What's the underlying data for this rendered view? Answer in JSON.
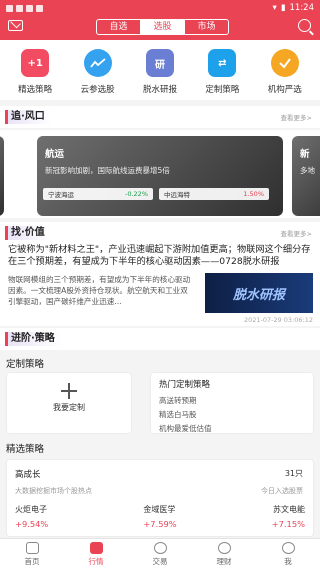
{
  "status": {
    "time": "11:24"
  },
  "nav": {
    "tabs": [
      "自选",
      "选股",
      "市场"
    ],
    "active_index": 1
  },
  "features": [
    {
      "label": "精选策略",
      "icon": "plus-one-ribbon-icon",
      "glyph": "+1"
    },
    {
      "label": "云参选股",
      "icon": "trend-cloud-icon",
      "glyph": ""
    },
    {
      "label": "脱水研报",
      "icon": "report-icon",
      "glyph": "研"
    },
    {
      "label": "定制策略",
      "icon": "custom-arrow-icon",
      "glyph": "⇄"
    },
    {
      "label": "机构严选",
      "icon": "institution-pick-icon",
      "glyph": ""
    }
  ],
  "sections": {
    "wind": {
      "title": "追·风口",
      "more": "查看更多>"
    },
    "value": {
      "title": "找·价值",
      "more": "查看更多>"
    },
    "advance": {
      "title": "进阶·策略"
    }
  },
  "carousel": {
    "main": {
      "title": "航运",
      "desc": "新冠影响加剧，国际航线运费暴增5倍",
      "stocks": [
        {
          "name": "宁波海运",
          "pct": "-0.22%"
        },
        {
          "name": "中远海特",
          "pct": "1.50%"
        }
      ]
    },
    "right": {
      "title": "新",
      "desc": "多地"
    }
  },
  "article": {
    "headline": "它被称为\"新材料之王\"，产业迅速崛起下游附加值更高；物联网这个细分存在三个预期差，有望成为下半年的核心驱动因素——0728脱水研报",
    "body": "物联网模组的三个预期差，有望成为下半年的核心驱动因素。一文梳理A股外资持仓现状。航空航天和工业双引擎驱动，国产碳纤维产业迅速...",
    "thumb_text": "脱水研报",
    "time": "2021-07-29 03:06:12"
  },
  "strategy": {
    "heading": "定制策略",
    "custom_label": "我要定制",
    "hot_title": "热门定制策略",
    "hot_items": [
      "高送转预期",
      "精选白马股",
      "机构最爱低估值"
    ]
  },
  "jingxuan": {
    "heading": "精选策略",
    "name": "高成长",
    "count": "31只",
    "desc": "大数据挖掘市场个股热点",
    "tag": "今日入选股票",
    "stocks": [
      {
        "name": "火炬电子",
        "pct": "+9.54%"
      },
      {
        "name": "金域医学",
        "pct": "+7.59%"
      },
      {
        "name": "苏文电能",
        "pct": "+7.15%"
      }
    ]
  },
  "tabbar": [
    "首页",
    "行情",
    "交易",
    "理财",
    "我"
  ],
  "tabbar_active_index": 1,
  "colors": {
    "brand": "#ea4354"
  }
}
